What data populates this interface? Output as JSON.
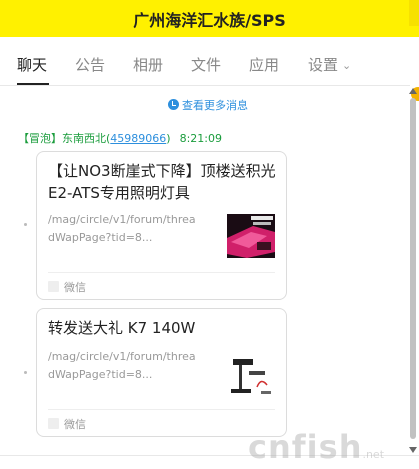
{
  "window": {
    "title": "广州海洋汇水族/SPS"
  },
  "tabs": [
    {
      "label": "聊天",
      "active": true
    },
    {
      "label": "公告"
    },
    {
      "label": "相册"
    },
    {
      "label": "文件"
    },
    {
      "label": "应用"
    },
    {
      "label": "设置",
      "has_dropdown": true,
      "dropdown_icon": "chevron-down"
    }
  ],
  "history": {
    "label": "查看更多消息",
    "icon": "clock"
  },
  "message": {
    "tag": "【冒泡】",
    "sender": "东南西北",
    "uid_open": "(",
    "uid": "45989066",
    "uid_close": ")",
    "time": "8:21:09"
  },
  "cards": [
    {
      "title": "【让NO3断崖式下降】顶楼送积光E2-ATS专用照明灯具",
      "url": "/mag/circle/v1/forum/threadWapPage?tid=8...",
      "thumbnail": "product-photo",
      "source": "微信"
    },
    {
      "title": "转发送大礼 K7 140W",
      "url": "/mag/circle/v1/forum/threadWapPage?tid=8...",
      "thumbnail": "lamp-photo",
      "source": "微信"
    }
  ],
  "watermark": {
    "main": "cnfish",
    "suffix": ".net"
  },
  "colors": {
    "titlebar": "#fff100",
    "link_blue": "#2d8fdd",
    "sender_green": "#1a9c3c",
    "tab_active": "#222222",
    "tab_inactive": "#888888"
  }
}
